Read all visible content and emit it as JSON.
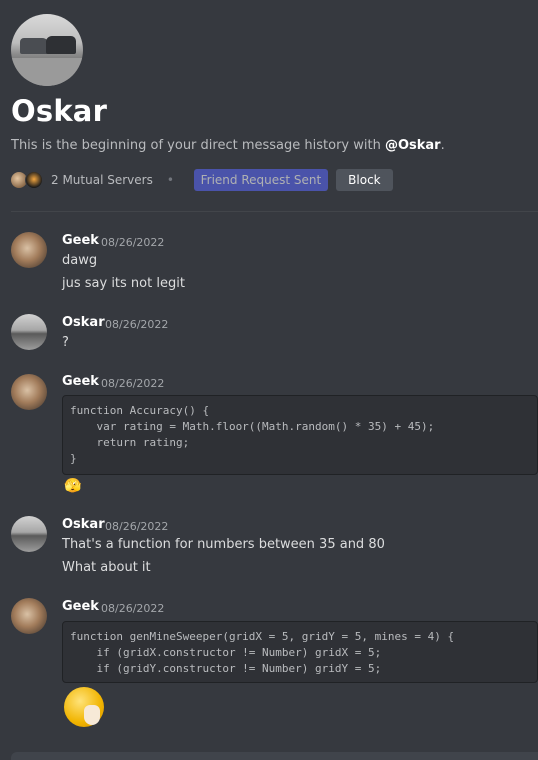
{
  "dm_header": {
    "name": "Oskar",
    "intro_prefix": "This is the beginning of your direct message history with ",
    "intro_handle": "@Oskar",
    "intro_suffix": ".",
    "mutual_servers": "2 Mutual Servers",
    "separator": "•",
    "friend_request_label": "Friend Request Sent",
    "block_label": "Block"
  },
  "messages": [
    {
      "author": "Geek",
      "timestamp": "08/26/2022",
      "lines": [
        "dawg",
        "jus say its not legit"
      ]
    },
    {
      "author": "Oskar",
      "timestamp": "08/26/2022",
      "lines": [
        "?"
      ]
    },
    {
      "author": "Geek",
      "timestamp": "08/26/2022",
      "code": "function Accuracy() {\n    var rating = Math.floor((Math.random() * 35) + 45);\n    return rating;\n}",
      "emoji": "🫣"
    },
    {
      "author": "Oskar",
      "timestamp": "08/26/2022",
      "lines": [
        "That's a function for numbers between 35 and 80",
        "What about it"
      ]
    },
    {
      "author": "Geek",
      "timestamp": "08/26/2022",
      "code": "function genMineSweeper(gridX = 5, gridY = 5, mines = 4) {\n    if (gridX.constructor != Number) gridX = 5;\n    if (gridY.constructor != Number) gridY = 5;"
    }
  ],
  "colors": {
    "background": "#36393f",
    "accent": "#5865f2",
    "code_bg": "#2f3136"
  }
}
